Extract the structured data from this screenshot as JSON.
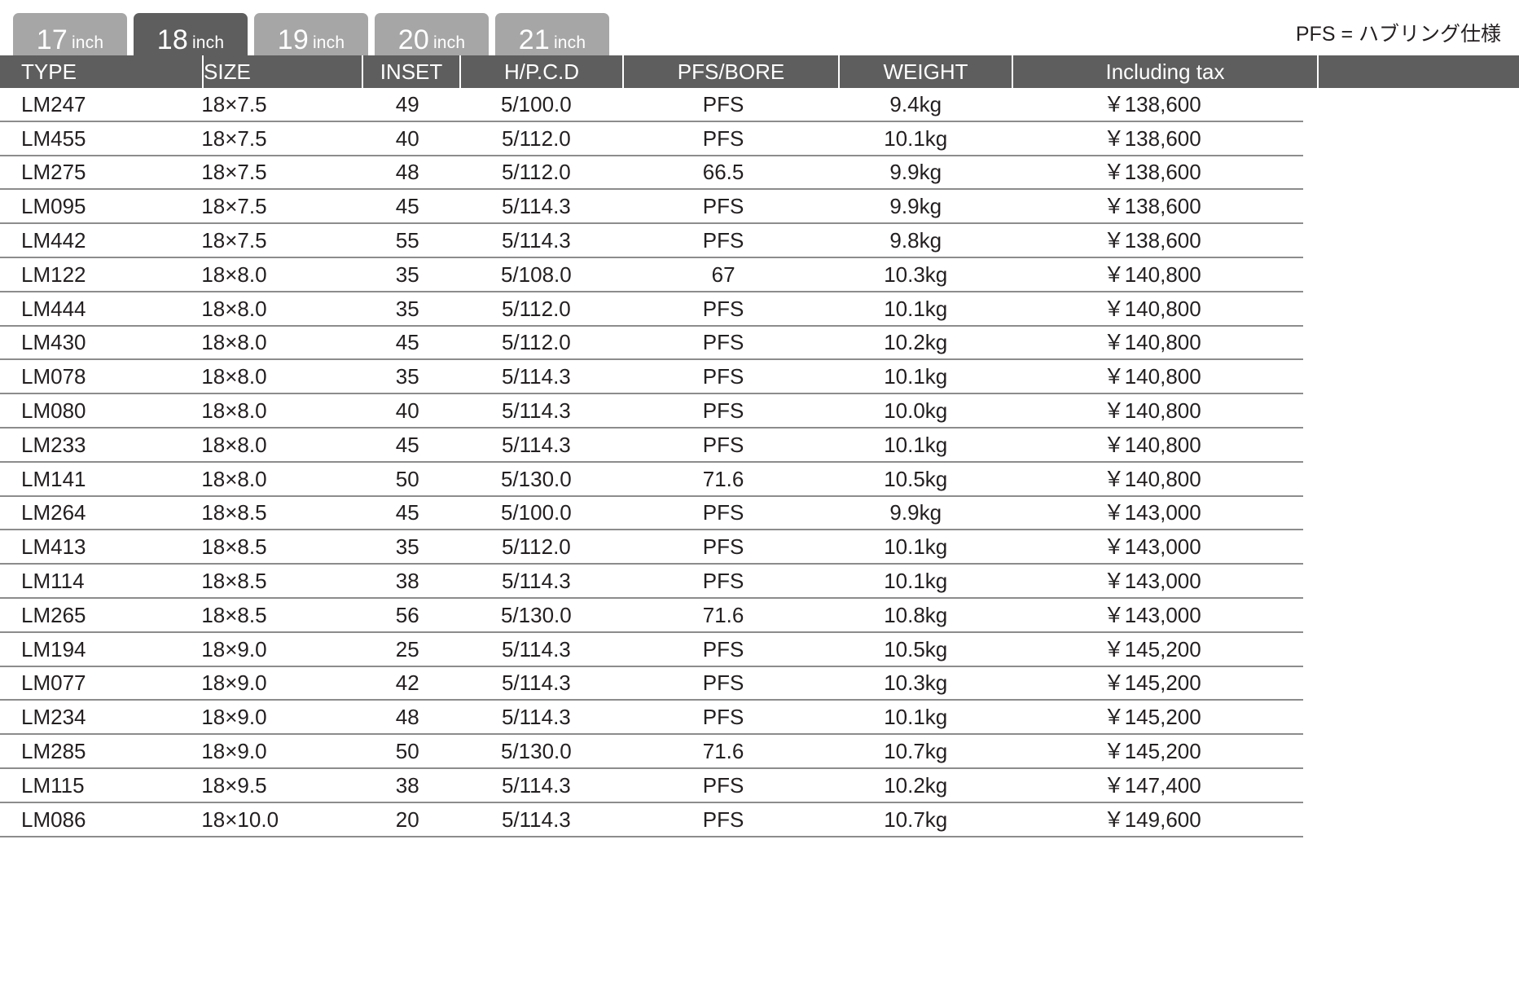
{
  "tabs": [
    {
      "num": "17",
      "unit": "inch",
      "active": false
    },
    {
      "num": "18",
      "unit": "inch",
      "active": true
    },
    {
      "num": "19",
      "unit": "inch",
      "active": false
    },
    {
      "num": "20",
      "unit": "inch",
      "active": false
    },
    {
      "num": "21",
      "unit": "inch",
      "active": false
    }
  ],
  "note": "PFS = ハブリング仕様",
  "colors": {
    "tab_inactive": "#a6a6a6",
    "tab_active": "#5e5e5e",
    "header_bg": "#5e5e5e",
    "row_rule": "#8c8c8c",
    "text": "#231f20"
  },
  "table": {
    "columns": [
      "TYPE",
      "SIZE",
      "INSET",
      "H/P.C.D",
      "PFS/BORE",
      "WEIGHT",
      "Including tax"
    ],
    "rows": [
      {
        "type": "LM247",
        "size": "18×7.5",
        "inset": "49",
        "hpcd": "5/100.0",
        "pfs": "PFS",
        "weight": "9.4kg",
        "tax": "￥138,600"
      },
      {
        "type": "LM455",
        "size": "18×7.5",
        "inset": "40",
        "hpcd": "5/112.0",
        "pfs": "PFS",
        "weight": "10.1kg",
        "tax": "￥138,600"
      },
      {
        "type": "LM275",
        "size": "18×7.5",
        "inset": "48",
        "hpcd": "5/112.0",
        "pfs": "66.5",
        "weight": "9.9kg",
        "tax": "￥138,600"
      },
      {
        "type": "LM095",
        "size": "18×7.5",
        "inset": "45",
        "hpcd": "5/114.3",
        "pfs": "PFS",
        "weight": "9.9kg",
        "tax": "￥138,600"
      },
      {
        "type": "LM442",
        "size": "18×7.5",
        "inset": "55",
        "hpcd": "5/114.3",
        "pfs": "PFS",
        "weight": "9.8kg",
        "tax": "￥138,600"
      },
      {
        "type": "LM122",
        "size": "18×8.0",
        "inset": "35",
        "hpcd": "5/108.0",
        "pfs": "67",
        "weight": "10.3kg",
        "tax": "￥140,800"
      },
      {
        "type": "LM444",
        "size": "18×8.0",
        "inset": "35",
        "hpcd": "5/112.0",
        "pfs": "PFS",
        "weight": "10.1kg",
        "tax": "￥140,800"
      },
      {
        "type": "LM430",
        "size": "18×8.0",
        "inset": "45",
        "hpcd": "5/112.0",
        "pfs": "PFS",
        "weight": "10.2kg",
        "tax": "￥140,800"
      },
      {
        "type": "LM078",
        "size": "18×8.0",
        "inset": "35",
        "hpcd": "5/114.3",
        "pfs": "PFS",
        "weight": "10.1kg",
        "tax": "￥140,800"
      },
      {
        "type": "LM080",
        "size": "18×8.0",
        "inset": "40",
        "hpcd": "5/114.3",
        "pfs": "PFS",
        "weight": "10.0kg",
        "tax": "￥140,800"
      },
      {
        "type": "LM233",
        "size": "18×8.0",
        "inset": "45",
        "hpcd": "5/114.3",
        "pfs": "PFS",
        "weight": "10.1kg",
        "tax": "￥140,800"
      },
      {
        "type": "LM141",
        "size": "18×8.0",
        "inset": "50",
        "hpcd": "5/130.0",
        "pfs": "71.6",
        "weight": "10.5kg",
        "tax": "￥140,800"
      },
      {
        "type": "LM264",
        "size": "18×8.5",
        "inset": "45",
        "hpcd": "5/100.0",
        "pfs": "PFS",
        "weight": "9.9kg",
        "tax": "￥143,000"
      },
      {
        "type": "LM413",
        "size": "18×8.5",
        "inset": "35",
        "hpcd": "5/112.0",
        "pfs": "PFS",
        "weight": "10.1kg",
        "tax": "￥143,000"
      },
      {
        "type": "LM114",
        "size": "18×8.5",
        "inset": "38",
        "hpcd": "5/114.3",
        "pfs": "PFS",
        "weight": "10.1kg",
        "tax": "￥143,000"
      },
      {
        "type": "LM265",
        "size": "18×8.5",
        "inset": "56",
        "hpcd": "5/130.0",
        "pfs": "71.6",
        "weight": "10.8kg",
        "tax": "￥143,000"
      },
      {
        "type": "LM194",
        "size": "18×9.0",
        "inset": "25",
        "hpcd": "5/114.3",
        "pfs": "PFS",
        "weight": "10.5kg",
        "tax": "￥145,200"
      },
      {
        "type": "LM077",
        "size": "18×9.0",
        "inset": "42",
        "hpcd": "5/114.3",
        "pfs": "PFS",
        "weight": "10.3kg",
        "tax": "￥145,200"
      },
      {
        "type": "LM234",
        "size": "18×9.0",
        "inset": "48",
        "hpcd": "5/114.3",
        "pfs": "PFS",
        "weight": "10.1kg",
        "tax": "￥145,200"
      },
      {
        "type": "LM285",
        "size": "18×9.0",
        "inset": "50",
        "hpcd": "5/130.0",
        "pfs": "71.6",
        "weight": "10.7kg",
        "tax": "￥145,200"
      },
      {
        "type": "LM115",
        "size": "18×9.5",
        "inset": "38",
        "hpcd": "5/114.3",
        "pfs": "PFS",
        "weight": "10.2kg",
        "tax": "￥147,400"
      },
      {
        "type": "LM086",
        "size": "18×10.0",
        "inset": "20",
        "hpcd": "5/114.3",
        "pfs": "PFS",
        "weight": "10.7kg",
        "tax": "￥149,600"
      }
    ]
  }
}
